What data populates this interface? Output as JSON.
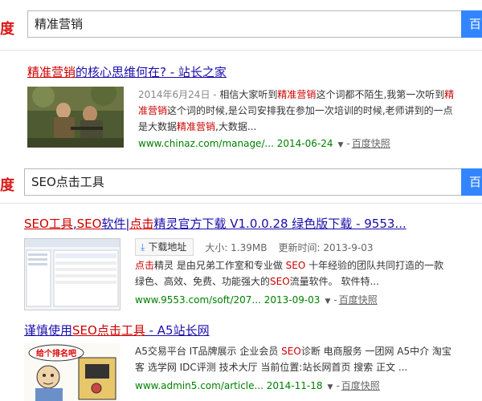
{
  "logo_fragment": "度",
  "panels": [
    {
      "search_query": "精准营销",
      "search_button": "百",
      "results": [
        {
          "title_parts": [
            {
              "t": "精准营销",
              "hl": true
            },
            {
              "t": "的核心思维何在? - 站长之家",
              "hl": false
            }
          ],
          "snippet_parts": [
            {
              "t": "2014年6月24日 - ",
              "c": "date"
            },
            {
              "t": "相信大家听到",
              "c": ""
            },
            {
              "t": "精准营销",
              "c": "hl"
            },
            {
              "t": "这个词都不陌生,我第一次听到",
              "c": ""
            },
            {
              "t": "精准营销",
              "c": "hl"
            },
            {
              "t": "这个词的时候,是公司安排我在参加一次培训的时候,老师讲到的一点是大数据",
              "c": ""
            },
            {
              "t": "精准营销",
              "c": "hl"
            },
            {
              "t": ",大数据...",
              "c": ""
            }
          ],
          "url": "www.chinaz.com/manage/... 2014-06-24",
          "snapshot": "百度快照"
        }
      ]
    },
    {
      "search_query": "SEO点击工具",
      "search_button": "百",
      "results": [
        {
          "title_parts": [
            {
              "t": "SEO工具",
              "hl": true
            },
            {
              "t": ",",
              "hl": false
            },
            {
              "t": "SEO",
              "hl": true
            },
            {
              "t": "软件|",
              "hl": false
            },
            {
              "t": "点击",
              "hl": true
            },
            {
              "t": "精灵官方下载 V1.0.0.28 绿色版下载 - 9553...",
              "hl": false
            }
          ],
          "download_label": "下载地址",
          "size_text": "大小: 1.39MB",
          "update_text": "更新时间: 2013-9-03",
          "snippet_parts": [
            {
              "t": "点击",
              "c": "hl"
            },
            {
              "t": "精灵 是由兄弟工作室和专业做 ",
              "c": ""
            },
            {
              "t": "SEO",
              "c": "hl"
            },
            {
              "t": " 十年经验的团队共同打造的一款绿色、高效、免费、功能强大的",
              "c": ""
            },
            {
              "t": "SEO",
              "c": "hl"
            },
            {
              "t": "流量软件。 软件特...",
              "c": ""
            }
          ],
          "url": "www.9553.com/soft/207... 2013-09-03",
          "snapshot": "百度快照"
        },
        {
          "title_parts": [
            {
              "t": "谨慎使用",
              "hl": false
            },
            {
              "t": "SEO点击工具",
              "hl": true
            },
            {
              "t": " - A5站长网",
              "hl": false
            }
          ],
          "snippet_parts": [
            {
              "t": "A5交易平台 IT品牌展示 企业会员 ",
              "c": ""
            },
            {
              "t": "SEO",
              "c": "hl"
            },
            {
              "t": "诊断 电商服务 一团网 A5中介 淘宝客 选学网 IDC评测 技术大厅 当前位置:站长网首页 搜索 正文 ...",
              "c": ""
            }
          ],
          "thumb_caption": "给个排名吧",
          "url": "www.admin5.com/article... 2014-11-18",
          "snapshot": "百度快照"
        }
      ]
    }
  ]
}
